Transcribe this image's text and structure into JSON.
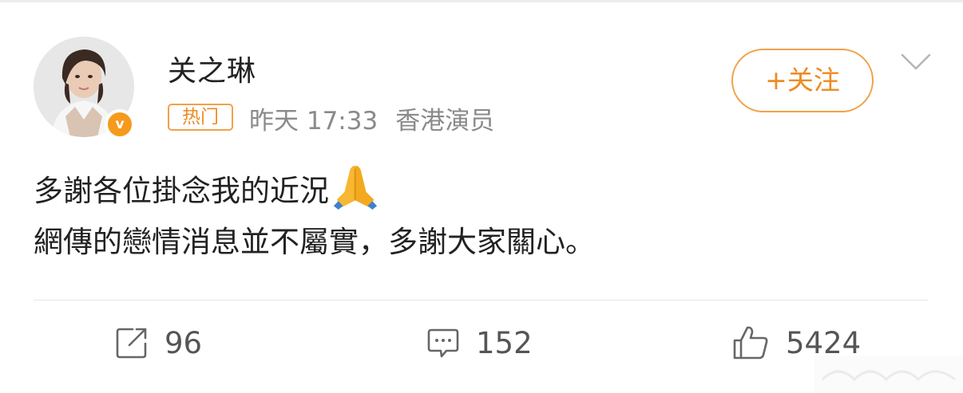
{
  "post": {
    "user": {
      "name": "关之琳",
      "avatar_icon": "avatar-photo",
      "verified_icon": "v-badge-icon",
      "verified_mark": "v"
    },
    "tag": "热门",
    "time": "昨天 17:33",
    "source": "香港演员",
    "follow_label": "+关注",
    "content": {
      "line1": "多謝各位掛念我的近況",
      "line1_emoji_icon": "folded-hands-icon",
      "line2": "網傳的戀情消息並不屬實，多謝大家關心。"
    },
    "actions": {
      "repost_count": "96",
      "comment_count": "152",
      "like_count": "5424"
    }
  },
  "colors": {
    "accent": "#ee8a21",
    "text": "#222222",
    "meta": "#8a8a8a",
    "badge": "#f59a1c"
  }
}
